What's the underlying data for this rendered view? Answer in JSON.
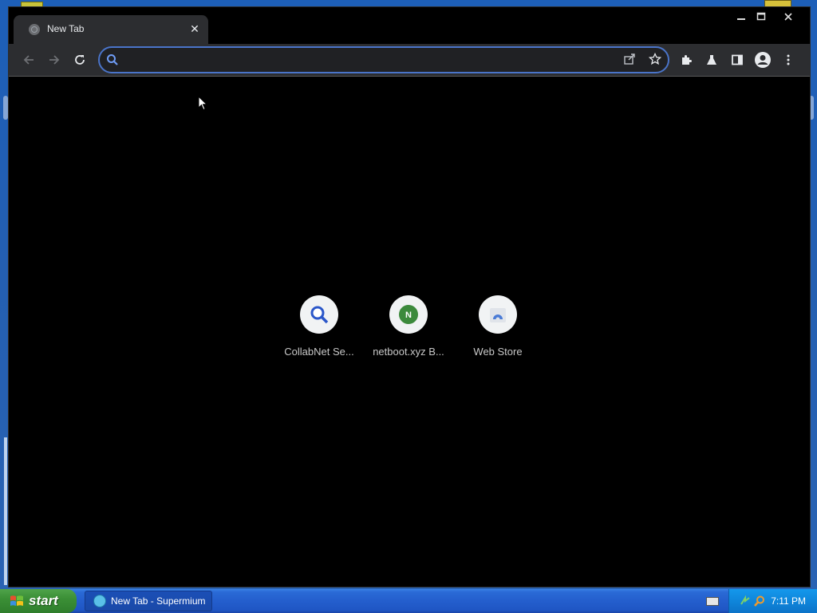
{
  "window": {
    "tab": {
      "title": "New Tab",
      "close_glyph": "✕"
    }
  },
  "omnibox": {
    "value": "",
    "placeholder": ""
  },
  "shortcuts": [
    {
      "label": "CollabNet Se...",
      "icon": "magnifier-icon"
    },
    {
      "label": "netboot.xyz B...",
      "icon": "netboot-n-icon"
    },
    {
      "label": "Web Store",
      "icon": "webstore-icon"
    }
  ],
  "taskbar": {
    "start_label": "start",
    "task_label": "New Tab - Supermium",
    "clock": "7:11 PM"
  },
  "colors": {
    "tab_bg": "#2c2d30",
    "omnibox_border": "#4a74c9",
    "xp_blue": "#245ecd",
    "start_green": "#3b8f36"
  }
}
